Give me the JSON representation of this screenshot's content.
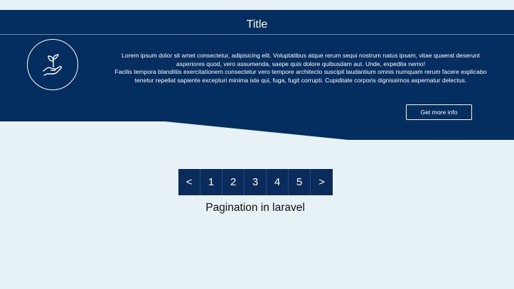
{
  "banner": {
    "title": "Title",
    "paragraph1": "Lorem ipsum dolor sit amet consectetur, adipisicing elit. Voluptatibus atque rerum sequi nostrum natus ipsam, vitae quaerat deserunt asperiores quod, vero assumenda, saepe quis dolore quibusdam aut. Unde, expedita nemo!",
    "paragraph2": "Facilis tempora blanditiis exercitationem consectetur vero tempore architecto suscipit laudantium omnis numquam rerum facere explicabo tenetur repellat sapiente excepturi minima iste qui, fuga, fugit corrupti. Cupiditate corporis dignissimos aspernatur delectus.",
    "button_label": "Get more info",
    "icon": "plant-hand-icon"
  },
  "pagination": {
    "prev": "<",
    "pages": [
      "1",
      "2",
      "3",
      "4",
      "5"
    ],
    "next": ">",
    "caption": "Pagination in laravel"
  },
  "colors": {
    "banner": "#042d60",
    "background": "#e6f2f5",
    "page_item": "#0a2c5c"
  }
}
